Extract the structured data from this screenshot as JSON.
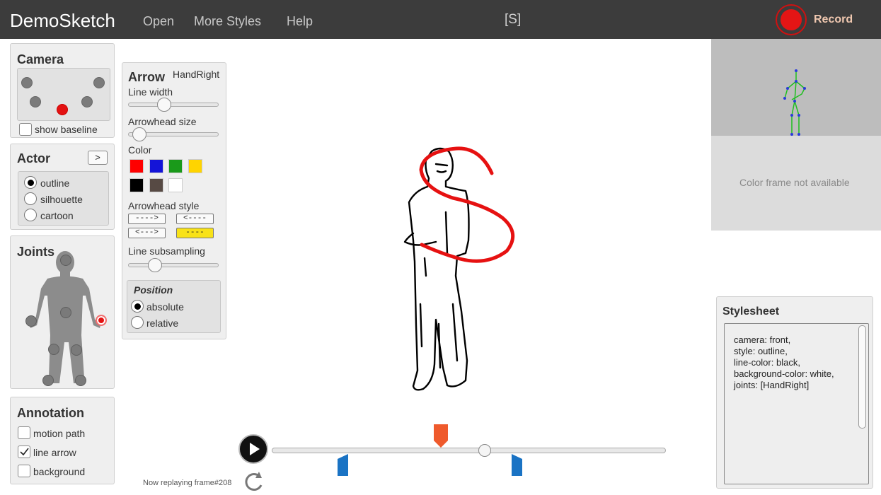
{
  "app": {
    "brand": "DemoSketch",
    "menu": [
      "Open",
      "More Styles",
      "Help"
    ],
    "shortcut": "[S]",
    "record_label": "Record"
  },
  "camera": {
    "title": "Camera",
    "baseline_label": "show baseline",
    "baseline_checked": false,
    "selected_camera": 3
  },
  "actor": {
    "title": "Actor",
    "next_button": ">",
    "options": [
      "outline",
      "silhouette",
      "cartoon"
    ],
    "selected": "outline"
  },
  "joints": {
    "title": "Joints",
    "selected": "HandRight"
  },
  "annotation": {
    "title": "Annotation",
    "items": [
      {
        "label": "motion path",
        "checked": false
      },
      {
        "label": "line arrow",
        "checked": true
      },
      {
        "label": "background",
        "checked": false
      }
    ]
  },
  "arrow": {
    "title": "Arrow",
    "joint": "HandRight",
    "line_width_label": "Line width",
    "line_width_value": 0.4,
    "arrowhead_size_label": "Arrowhead size",
    "arrowhead_size_value": 0.1,
    "color_label": "Color",
    "colors": [
      "#ff0000",
      "#1414d8",
      "#1a9a1a",
      "#ffd400",
      "#000000",
      "#574a44",
      "#ffffff"
    ],
    "arrowhead_style_label": "Arrowhead style",
    "styles": [
      "---->",
      "<----",
      "<--->",
      "----"
    ],
    "selected_style": "----",
    "subsampling_label": "Line subsampling",
    "subsampling_value": 0.3,
    "position_title": "Position",
    "position_options": [
      "absolute",
      "relative"
    ],
    "position_selected": "absolute"
  },
  "preview": {
    "color_frame_text": "Color frame not available"
  },
  "stylesheet": {
    "title": "Stylesheet",
    "lines": [
      "camera: front,",
      "style: outline,",
      "line-color: black,",
      "background-color: white,",
      "joints: [HandRight]"
    ]
  },
  "timeline": {
    "status_text": "Now replaying frame#208",
    "playhead_position": 0.54
  }
}
